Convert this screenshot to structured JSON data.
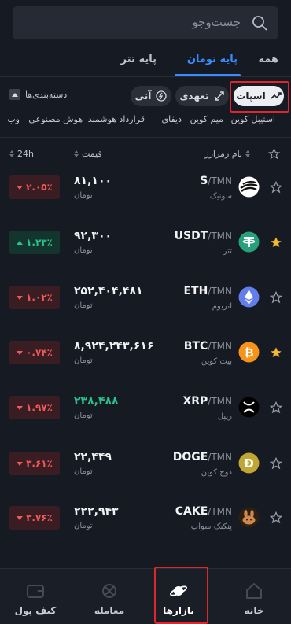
{
  "search": {
    "placeholder": "جست‌وجو"
  },
  "top_tabs": [
    {
      "label": "همه"
    },
    {
      "label": "پایه تومان"
    },
    {
      "label": "پایه تتر"
    }
  ],
  "filters": {
    "spot": "اسپات",
    "futures": "تعهدی",
    "instant": "آنی",
    "categories_toggle": "دسته‌بندی‌ها"
  },
  "categories": [
    "استیبل کوین",
    "میم کوین",
    "دیفای",
    "قرارداد هوشمند",
    "هوش مصنوعی",
    "وب"
  ],
  "columns": {
    "name": "نام رمزارز",
    "price": "قیمت",
    "change": "24h"
  },
  "rows": [
    {
      "base": "S",
      "quote": "/TMN",
      "name": "سونیک",
      "price": "۸۱,۱۰۰",
      "unit": "تومان",
      "change": "۲.۰۵٪",
      "dir": "down",
      "starred": false,
      "logo": "sonic-logo"
    },
    {
      "base": "USDT",
      "quote": "/TMN",
      "name": "تتر",
      "price": "۹۲,۳۰۰",
      "unit": "تومان",
      "change": "۱.۲۳٪",
      "dir": "up",
      "starred": true,
      "logo": "tether-logo"
    },
    {
      "base": "ETH",
      "quote": "/TMN",
      "name": "اتریوم",
      "price": "۲۵۲,۴۰۴,۴۸۱",
      "unit": "تومان",
      "change": "۱.۰۲٪",
      "dir": "down",
      "starred": false,
      "logo": "ethereum-logo"
    },
    {
      "base": "BTC",
      "quote": "/TMN",
      "name": "بیت کوین",
      "price": "۸,۹۲۴,۲۴۳,۶۱۶",
      "unit": "تومان",
      "change": "۰.۷۴٪",
      "dir": "down",
      "starred": true,
      "logo": "bitcoin-logo"
    },
    {
      "base": "XRP",
      "quote": "/TMN",
      "name": "ریپل",
      "price": "۲۳۸,۴۸۸",
      "unit": "تومان",
      "change": "۱.۹۷٪",
      "dir": "down",
      "starred": false,
      "logo": "xrp-logo",
      "price_color": "green"
    },
    {
      "base": "DOGE",
      "quote": "/TMN",
      "name": "دوج کوین",
      "price": "۲۲,۴۴۹",
      "unit": "تومان",
      "change": "۳.۶۱٪",
      "dir": "down",
      "starred": false,
      "logo": "dogecoin-logo"
    },
    {
      "base": "CAKE",
      "quote": "/TMN",
      "name": "پنکیک سواپ",
      "price": "۲۲۲,۹۴۳",
      "unit": "تومان",
      "change": "۳.۷۶٪",
      "dir": "down",
      "starred": false,
      "logo": "pancakeswap-logo"
    }
  ],
  "bottom_nav": [
    {
      "label": "کیف پول",
      "icon": "wallet-icon"
    },
    {
      "label": "معامله",
      "icon": "trade-icon"
    },
    {
      "label": "بازارها",
      "icon": "planet-icon",
      "active": true
    },
    {
      "label": "خانه",
      "icon": "home-icon"
    }
  ],
  "colors": {
    "accent": "#3a8dff",
    "negative": "#f05a5a",
    "positive": "#29c28f",
    "star": "#f5b82e",
    "highlight": "#e0262b"
  }
}
